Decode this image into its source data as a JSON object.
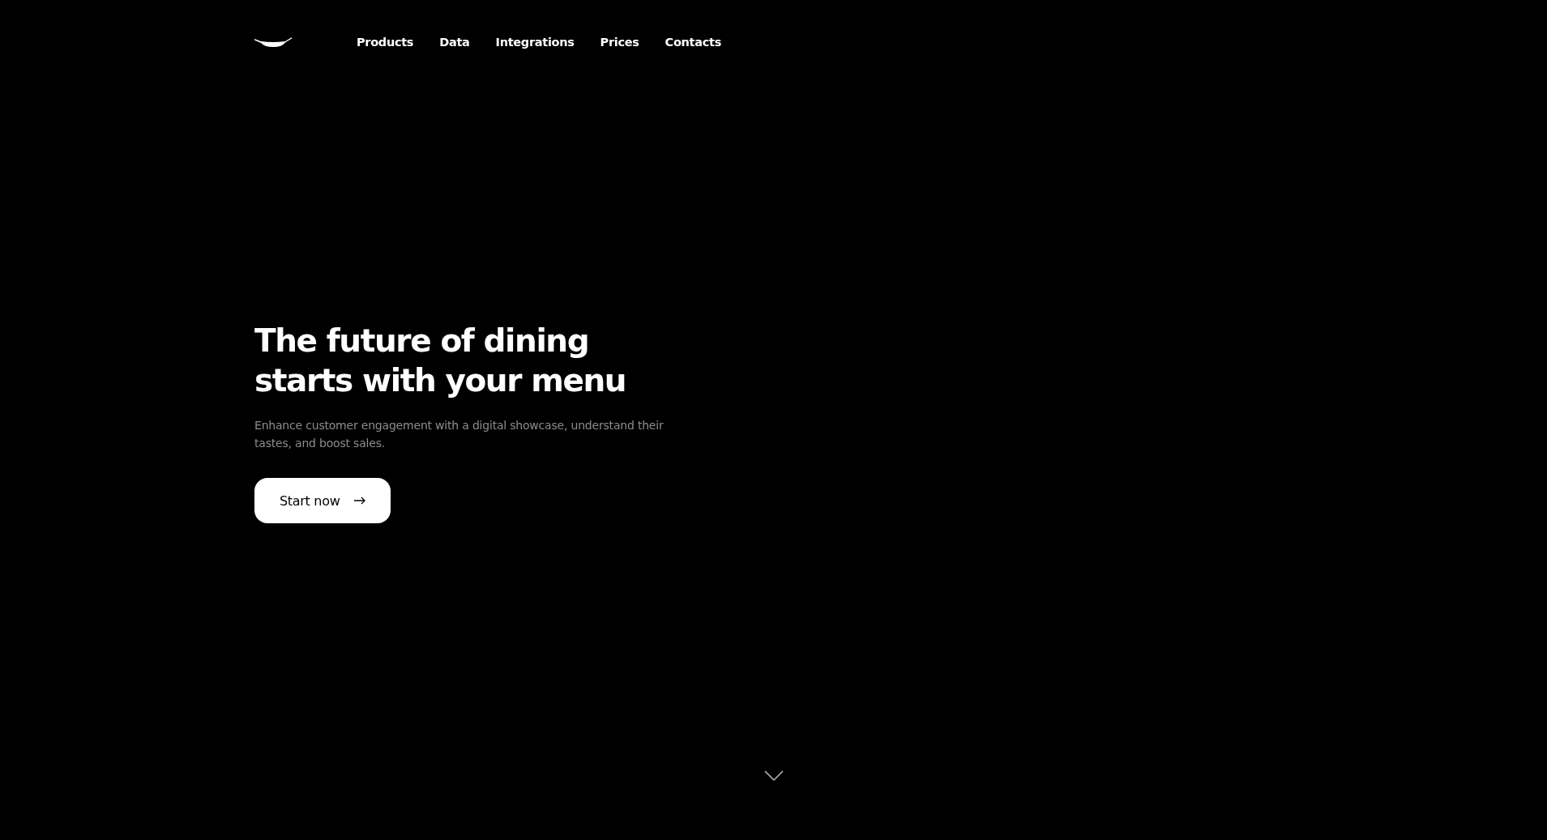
{
  "nav": [
    {
      "label": "Products"
    },
    {
      "label": "Data"
    },
    {
      "label": "Integrations"
    },
    {
      "label": "Prices"
    },
    {
      "label": "Contacts"
    }
  ],
  "hero": {
    "title": "The future of dining starts with your menu",
    "subtitle": "Enhance customer engagement with a digital showcase, understand their tastes, and boost sales.",
    "cta": "Start now"
  }
}
